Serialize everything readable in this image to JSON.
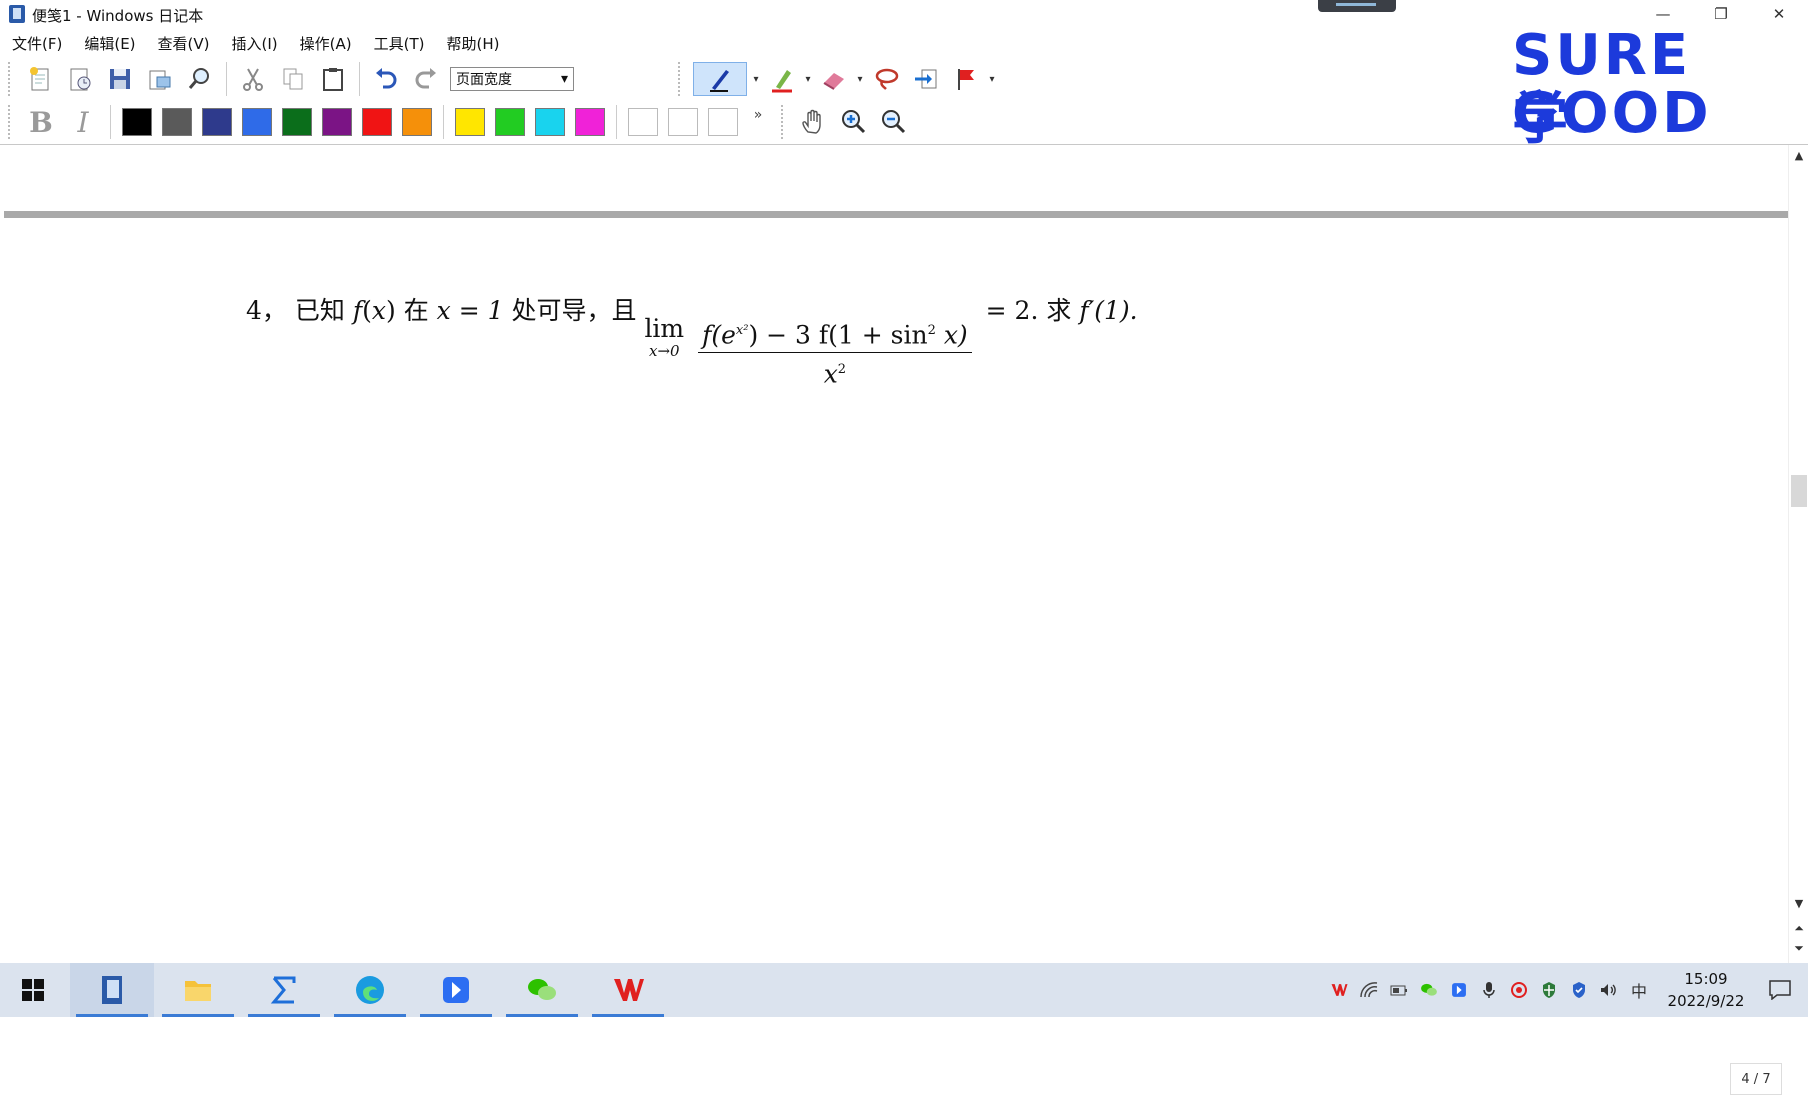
{
  "window": {
    "title": "便笺1 - Windows 日记本",
    "minimize_glyph": "—",
    "restore_glyph": "❐",
    "close_glyph": "✕"
  },
  "menu": [
    "文件(F)",
    "编辑(E)",
    "查看(V)",
    "插入(I)",
    "操作(A)",
    "工具(T)",
    "帮助(H)"
  ],
  "toolbar": {
    "zoom_value": "页面宽度",
    "bold_label": "B",
    "italic_label": "I",
    "more_glyph": "»",
    "dropdown_glyph": "▾"
  },
  "colors": {
    "swatches": [
      "#000000",
      "#5a5a5a",
      "#2e3a8c",
      "#2f6be8",
      "#0b6e1b",
      "#7b1485",
      "#f01414",
      "#f5900a",
      "#ffe600",
      "#22cc22",
      "#19d3ee",
      "#f022d8"
    ],
    "accent": "#1c3adb"
  },
  "logo": {
    "line1": "SURE 学",
    "line2": "GOOD 冠"
  },
  "document": {
    "problem": {
      "number": "4，",
      "lead": "已知",
      "func": "f",
      "var": "x",
      "at": "在",
      "condition": "x = 1",
      "diff_text": "处可导，且",
      "lim": "lim",
      "lim_sub": "x→0",
      "numerator_pre": "f(e",
      "numerator_sup": "x²",
      "numerator_mid": ") − 3 f(1 + sin",
      "numerator_sup2": "2",
      "numerator_post": " x)",
      "denominator": "x",
      "denominator_sup": "2",
      "equals": "= 2.",
      "ask": "求",
      "target": "f′(1)."
    }
  },
  "page_indicator": "4 / 7",
  "taskbar": {
    "ime": "中",
    "time": "15:09",
    "date": "2022/9/22"
  }
}
